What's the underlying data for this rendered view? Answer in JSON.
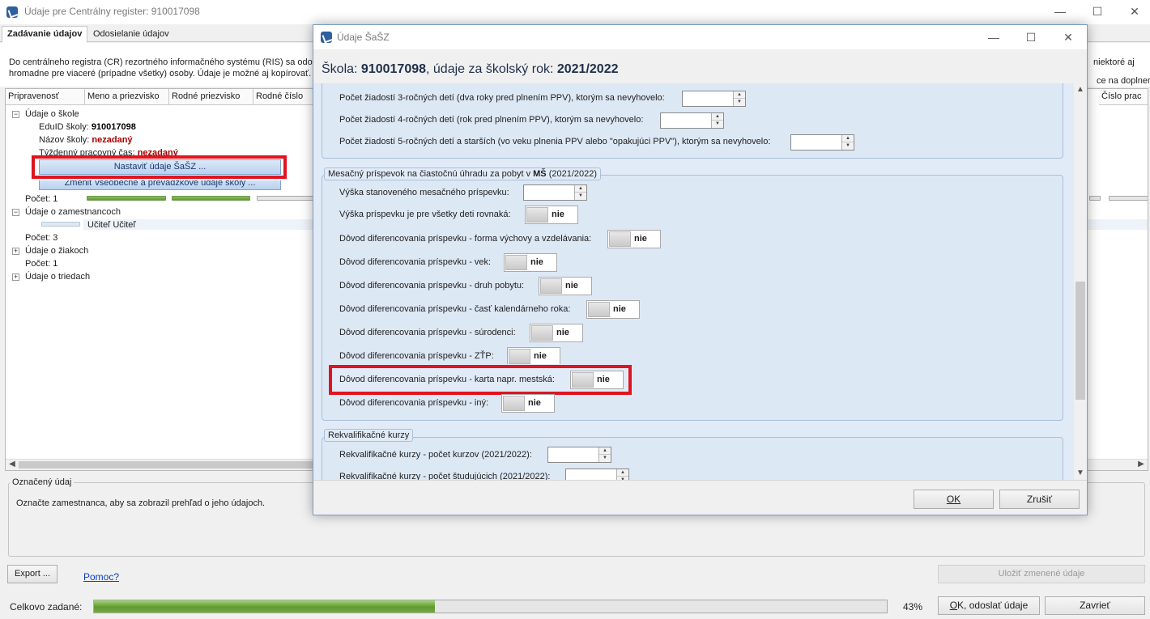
{
  "window": {
    "title": "Údaje pre Centrálny register: 910017098",
    "minimize": "—",
    "maximize": "☐",
    "close": "✕"
  },
  "tabs": [
    {
      "label": "Zadávanie údajov"
    },
    {
      "label": "Odosielanie údajov"
    }
  ],
  "description": {
    "line1": "Do centrálneho registra (CR) rezortného informačného systému (RIS) sa odo",
    "line2": "hromadne pre viaceré (prípadne všetky) osoby. Údaje je možné aj kopírovať.",
    "right_line1": "niektoré aj",
    "right_line2": "ce na doplnenie"
  },
  "grid": {
    "columns": [
      "Pripravenosť",
      "Meno a priezvisko",
      "Rodné priezvisko",
      "Rodné číslo"
    ],
    "right_column": "Číslo prac",
    "tree": {
      "school_node": "Údaje o škole",
      "eduid_label": "EduID školy:",
      "eduid_value": "910017098",
      "name_label": "Názov školy:",
      "name_value": "nezadaný",
      "weekly_label": "Týždenný pracovný čas:",
      "weekly_value": "nezadaný",
      "btn_set_sasz": "Nastaviť údaje ŠaŠZ ...",
      "btn_change_general": "Zmeniť všeobecné a prevádzkové údaje školy ...",
      "count1": "Počet: 1",
      "employees_node": "Údaje o zamestnancoch",
      "employee_name": "Učiteľ Učiteľ",
      "count3": "Počet: 3",
      "students_node": "Údaje o žiakoch",
      "count1b": "Počet: 1",
      "classes_node": "Údaje o triedach"
    }
  },
  "marked_data": {
    "legend": "Označený údaj",
    "text": "Označte zamestnanca, aby sa zobrazil prehľad o jeho údajoch."
  },
  "bottom": {
    "export_label": "Export ...",
    "help_label": "Pomoc?",
    "save_label": "Uložiť zmenené údaje",
    "total_label": "Celkovo zadané:",
    "progress_percent": 43,
    "progress_text": "43%",
    "ok_send_label": "OK, odoslať údaje",
    "close_label": "Zavrieť"
  },
  "dialog": {
    "title": "Údaje ŠaŠZ",
    "school_prefix": "Škola: ",
    "school_id": "910017098",
    "year_prefix": ", údaje za školský rok: ",
    "year": "2021/2022",
    "requests_rows": [
      "Počet žiadostí 3-ročných detí (dva roky pred plnením PPV), ktorým sa nevyhovelo:",
      "Počet žiadostí 4-ročných detí (rok pred plnením PPV), ktorým sa nevyhovelo:",
      "Počet žiadostí 5-ročných detí a starších (vo veku plnenia PPV alebo \"opakujúci PPV\"), ktorým sa nevyhovelo:"
    ],
    "monthly_group": {
      "legend_prefix": "Mesačný príspevok na čiastočnú úhradu za pobyt v ",
      "legend_bold": "MŠ",
      "legend_suffix": " (2021/2022)",
      "amount_label": "Výška stanoveného mesačného príspevku:",
      "equal_label": "Výška príspevku je pre všetky deti rovnaká:",
      "rows": [
        "Dôvod diferencovania príspevku - forma výchovy a vzdelávania:",
        "Dôvod diferencovania príspevku - vek:",
        "Dôvod diferencovania príspevku - druh pobytu:",
        "Dôvod diferencovania príspevku - časť kalendárneho roka:",
        "Dôvod diferencovania príspevku - súrodenci:",
        "Dôvod diferencovania príspevku - ZŤP:",
        "Dôvod diferencovania príspevku - karta napr. mestská:",
        "Dôvod diferencovania príspevku - iný:"
      ],
      "toggle_value": "nie"
    },
    "requal_group": {
      "legend": "Rekvalifikačné kurzy",
      "rows": [
        "Rekvalifikačné kurzy - počet kurzov (2021/2022):",
        "Rekvalifikačné kurzy - počet študujúcich (2021/2022):"
      ]
    },
    "ok_label": "OK",
    "cancel_label": "Zrušiť"
  },
  "colors": {
    "highlight": "#e0141f",
    "accent": "#2f5f9e",
    "panel": "#dde8f5"
  }
}
